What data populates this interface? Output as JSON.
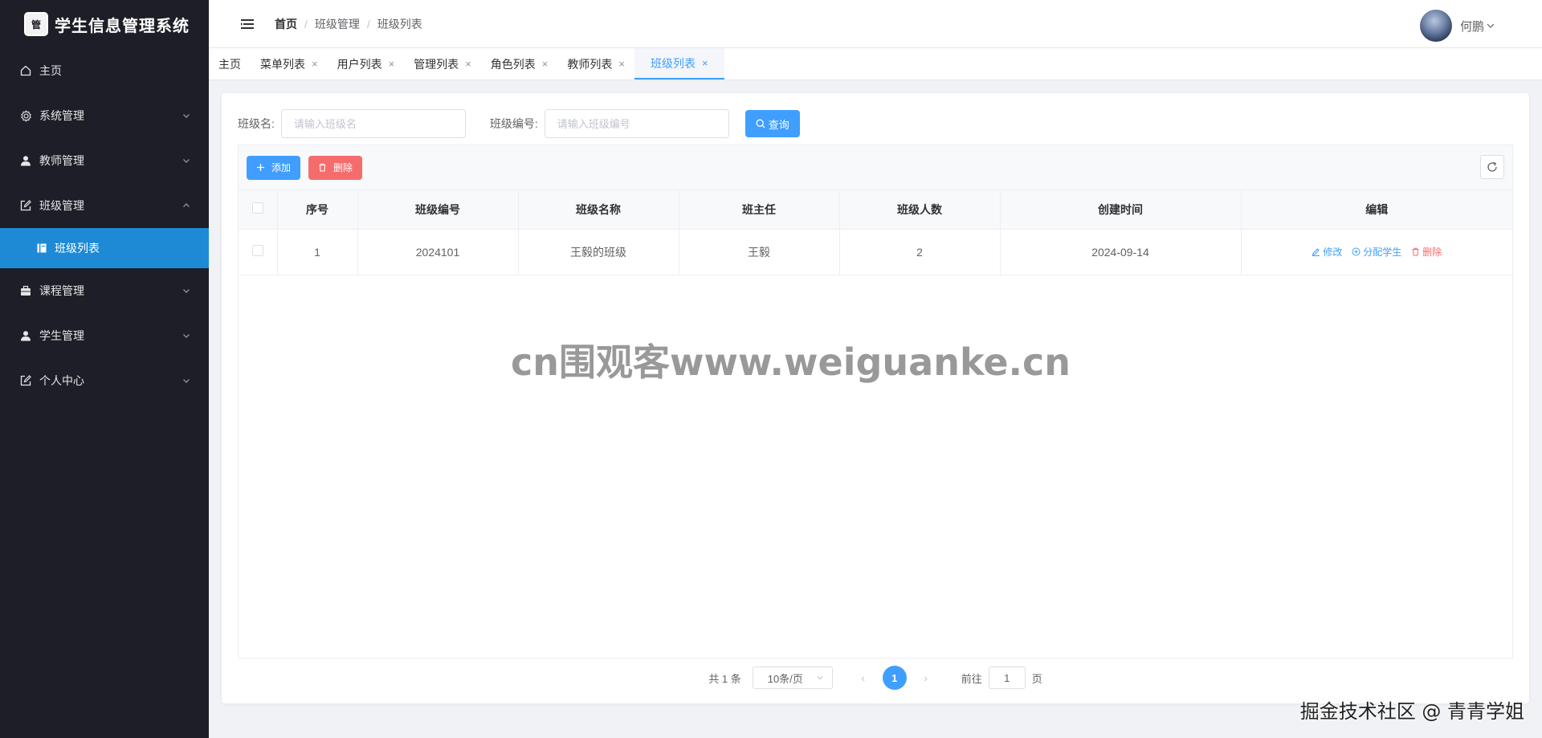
{
  "app": {
    "title": "学生信息管理系统",
    "logo_mark": "管"
  },
  "sidebar": {
    "items": [
      {
        "label": "主页",
        "icon": "home-icon",
        "expandable": false
      },
      {
        "label": "系统管理",
        "icon": "gear-icon",
        "expandable": true
      },
      {
        "label": "教师管理",
        "icon": "user-icon",
        "expandable": true
      },
      {
        "label": "班级管理",
        "icon": "edit-icon",
        "expandable": true,
        "expanded": true
      },
      {
        "label": "课程管理",
        "icon": "briefcase-icon",
        "expandable": true
      },
      {
        "label": "学生管理",
        "icon": "user-icon",
        "expandable": true
      },
      {
        "label": "个人中心",
        "icon": "edit-icon",
        "expandable": true
      }
    ],
    "sub_active": {
      "label": "班级列表",
      "icon": "notebook-icon"
    }
  },
  "header": {
    "breadcrumb": [
      "首页",
      "班级管理",
      "班级列表"
    ],
    "separator": "/",
    "user_name": "何鹏"
  },
  "tabs": [
    {
      "label": "主页",
      "closable": false
    },
    {
      "label": "菜单列表",
      "closable": true
    },
    {
      "label": "用户列表",
      "closable": true
    },
    {
      "label": "管理列表",
      "closable": true
    },
    {
      "label": "角色列表",
      "closable": true
    },
    {
      "label": "教师列表",
      "closable": true
    },
    {
      "label": "班级列表",
      "closable": true,
      "active": true
    }
  ],
  "filters": {
    "class_name_label": "班级名:",
    "class_name_placeholder": "请输入班级名",
    "class_no_label": "班级编号:",
    "class_no_placeholder": "请输入班级编号",
    "search_label": "查询"
  },
  "toolbar": {
    "add_label": "添加",
    "delete_label": "删除"
  },
  "table": {
    "columns": [
      "序号",
      "班级编号",
      "班级名称",
      "班主任",
      "班级人数",
      "创建时间",
      "编辑"
    ],
    "rows": [
      {
        "index": "1",
        "class_no": "2024101",
        "class_name": "王毅的班级",
        "teacher": "王毅",
        "count": "2",
        "created": "2024-09-14"
      }
    ],
    "actions": {
      "edit": "修改",
      "assign": "分配学生",
      "delete": "删除"
    }
  },
  "pagination": {
    "total": "共 1 条",
    "page_size": "10条/页",
    "current_page": "1",
    "goto_prefix": "前往",
    "goto_value": "1",
    "goto_suffix": "页"
  },
  "watermarks": {
    "center": "cn围观客www.weiguanke.cn",
    "corner": "掘金技术社区 @ 青青学姐"
  },
  "colors": {
    "sidebar_bg": "#1d1e27",
    "active_submenu": "#1e8ad6",
    "primary": "#409eff",
    "danger": "#f56c6c"
  }
}
